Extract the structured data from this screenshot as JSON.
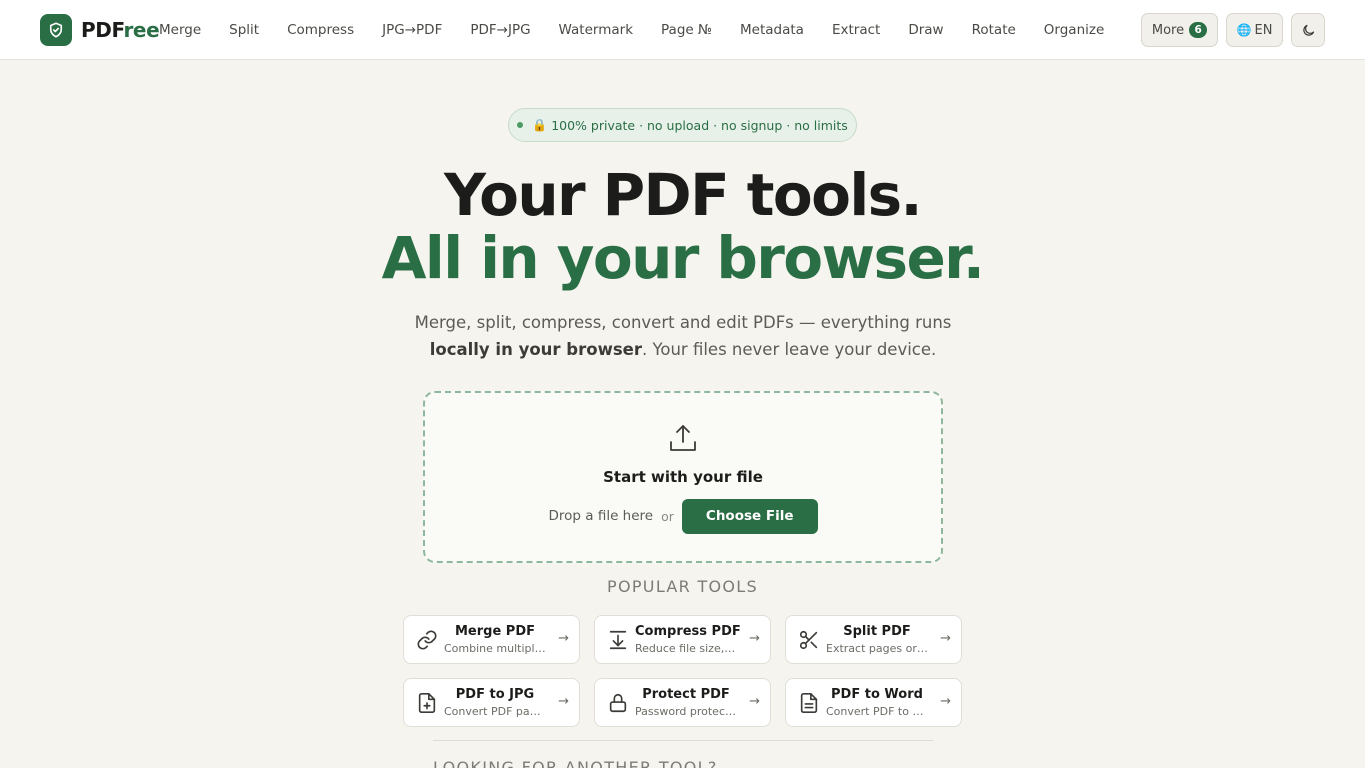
{
  "header": {
    "logo": {
      "part1": "PDF",
      "part2": "ree"
    },
    "nav": [
      "Merge",
      "Split",
      "Compress",
      "JPG→PDF",
      "PDF→JPG",
      "Watermark",
      "Page №",
      "Metadata",
      "Extract",
      "Draw",
      "Rotate",
      "Organize"
    ],
    "more_label": "More",
    "more_count": "6",
    "lang_icon": "🌐",
    "lang_label": "EN",
    "theme_icon": "moon-icon"
  },
  "hero": {
    "pill_lock": "🔒",
    "pill_text": "100% private · no upload · no signup · no limits",
    "title_line1": "Your PDF tools.",
    "title_line2": "All in your browser.",
    "subtitle_before": "Merge, split, compress, convert and edit PDFs — everything runs ",
    "subtitle_bold": "locally in your browser",
    "subtitle_after": ". Your files never leave your device."
  },
  "dropzone": {
    "title": "Start with your file",
    "drop_text": "Drop a file here",
    "or_text": "or",
    "button_label": "Choose File"
  },
  "popular": {
    "label": "POPULAR TOOLS",
    "tools": [
      {
        "name": "Merge PDF",
        "desc": "Combine multiple PDFs into one",
        "icon": "link-icon"
      },
      {
        "name": "Compress PDF",
        "desc": "Reduce file size, keep quality",
        "icon": "compress-icon"
      },
      {
        "name": "Split PDF",
        "desc": "Extract pages or split files",
        "icon": "scissors-icon"
      },
      {
        "name": "PDF to JPG",
        "desc": "Convert PDF pages to images",
        "icon": "file-plus-icon"
      },
      {
        "name": "Protect PDF",
        "desc": "Password protection for files",
        "icon": "lock-icon"
      },
      {
        "name": "PDF to Word",
        "desc": "Convert PDF to editable doc",
        "icon": "document-icon"
      }
    ],
    "arrow": "→"
  },
  "another": {
    "label": "LOOKING FOR ANOTHER TOOL?"
  },
  "colors": {
    "accent": "#2a6e45",
    "background": "#f5f4ef",
    "pill_bg": "#e8f1e9"
  }
}
